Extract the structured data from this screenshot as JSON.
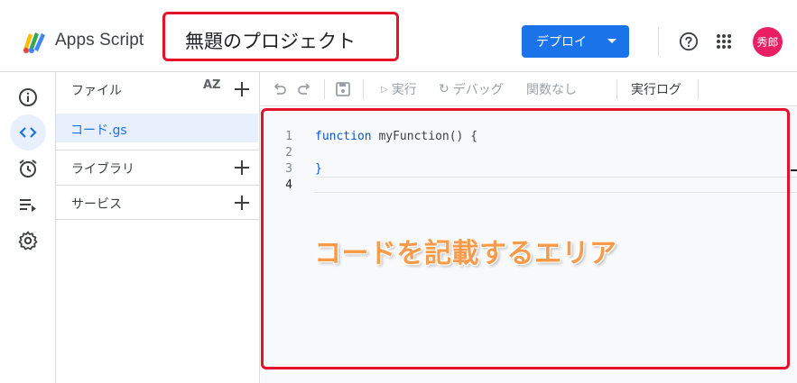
{
  "header": {
    "app_name": "Apps Script",
    "project_title": "無題のプロジェクト",
    "deploy_label": "デプロイ",
    "avatar_text": "秀郎",
    "avatar_color": "#e91e63",
    "accent_color": "#1a73e8",
    "highlight_color": "#e8112c"
  },
  "rail": {
    "items": [
      {
        "icon": "info-icon",
        "label": "概要"
      },
      {
        "icon": "code-icon",
        "label": "エディタ",
        "active": true
      },
      {
        "icon": "alarm-icon",
        "label": "トリガー"
      },
      {
        "icon": "executions-icon",
        "label": "実行数"
      },
      {
        "icon": "gear-icon",
        "label": "プロジェクトの設定"
      }
    ]
  },
  "files": {
    "title": "ファイル",
    "sort_icon_text": "AZ",
    "items": [
      "コード.gs"
    ],
    "sections": [
      "ライブラリ",
      "サービス"
    ]
  },
  "toolbar": {
    "run_label": "実行",
    "debug_label": "デバッグ",
    "function_label": "関数なし",
    "log_label": "実行ログ"
  },
  "editor": {
    "lines": [
      {
        "n": "1",
        "keyword": "function",
        "rest": " myFunction() {"
      },
      {
        "n": "2",
        "keyword": "",
        "rest": ""
      },
      {
        "n": "3",
        "keyword": "",
        "rest": "}"
      },
      {
        "n": "4",
        "keyword": "",
        "rest": ""
      }
    ],
    "annotation": "コードを記載するエリア"
  }
}
